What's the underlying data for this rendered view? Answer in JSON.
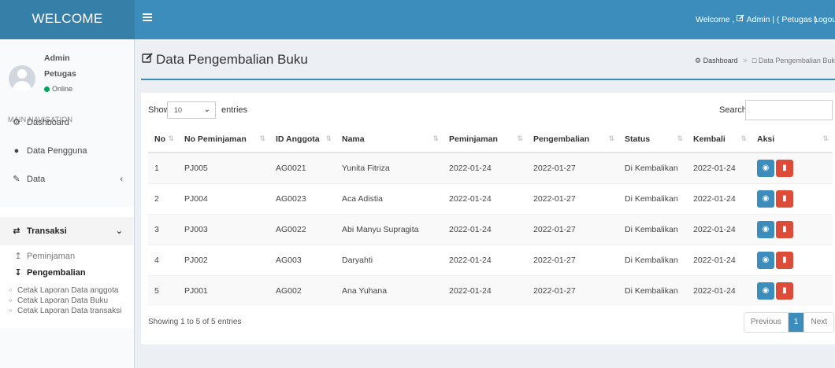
{
  "header": {
    "logo": "WELCOME",
    "menu_icon": "hamburger-icon",
    "welcome_text": "Welcome ,",
    "user_text": "Admin | ( Petugas )",
    "logout": "Logou"
  },
  "sidebar": {
    "user_name": "Admin",
    "user_role": "Petugas",
    "status": "Online",
    "nav_header": "MAIN NAVIGATION",
    "items": [
      {
        "label": "Dashboard",
        "icon": "dashboard-icon"
      },
      {
        "label": "Data Pengguna",
        "icon": "user-icon"
      },
      {
        "label": "Data",
        "icon": "edit-icon"
      },
      {
        "label": "Transaksi",
        "icon": "exchange-icon"
      }
    ],
    "sub_items": [
      {
        "label": "Peminjaman",
        "icon": "upload-icon"
      },
      {
        "label": "Pengembalian",
        "icon": "download-icon"
      }
    ],
    "reports": [
      "Cetak Laporan Data anggota",
      "Cetak Laporan Data Buku",
      "Cetak Laporan Data transaksi"
    ]
  },
  "page": {
    "title": "Data Pengembalian Buku",
    "breadcrumb": {
      "home": "Dashboard",
      "current": "Data Pengembalian Buku"
    }
  },
  "table": {
    "show_label": "Show",
    "length_value": "10",
    "entries_label": "entries",
    "search_label": "Search:",
    "search_value": "",
    "columns": [
      "No",
      "No Peminjaman",
      "ID Anggota",
      "Nama",
      "Peminjaman",
      "Pengembalian",
      "Status",
      "Kembali",
      "Aksi"
    ],
    "rows": [
      [
        "1",
        "PJ005",
        "AG0021",
        "Yunita Fitriza",
        "2022-01-24",
        "2022-01-27",
        "Di Kembalikan",
        "2022-01-24"
      ],
      [
        "2",
        "PJ004",
        "AG0023",
        "Aca Adistia",
        "2022-01-24",
        "2022-01-27",
        "Di Kembalikan",
        "2022-01-24"
      ],
      [
        "3",
        "PJ003",
        "AG0022",
        "Abi Manyu Supragita",
        "2022-01-24",
        "2022-01-27",
        "Di Kembalikan",
        "2022-01-24"
      ],
      [
        "4",
        "PJ002",
        "AG003",
        "Daryahti",
        "2022-01-24",
        "2022-01-27",
        "Di Kembalikan",
        "2022-01-24"
      ],
      [
        "5",
        "PJ001",
        "AG002",
        "Ana Yuhana",
        "2022-01-24",
        "2022-01-27",
        "Di Kembalikan",
        "2022-01-24"
      ]
    ],
    "info": "Showing 1 to 5 of 5 entries",
    "pagination": {
      "previous": "Previous",
      "current": "1",
      "next": "Next"
    }
  },
  "colors": {
    "header": "#3c8dbc",
    "logo_bg": "#367fa9",
    "view_button": "#3c8dbc",
    "delete_button": "#dd4b39",
    "online": "#00a65a"
  }
}
